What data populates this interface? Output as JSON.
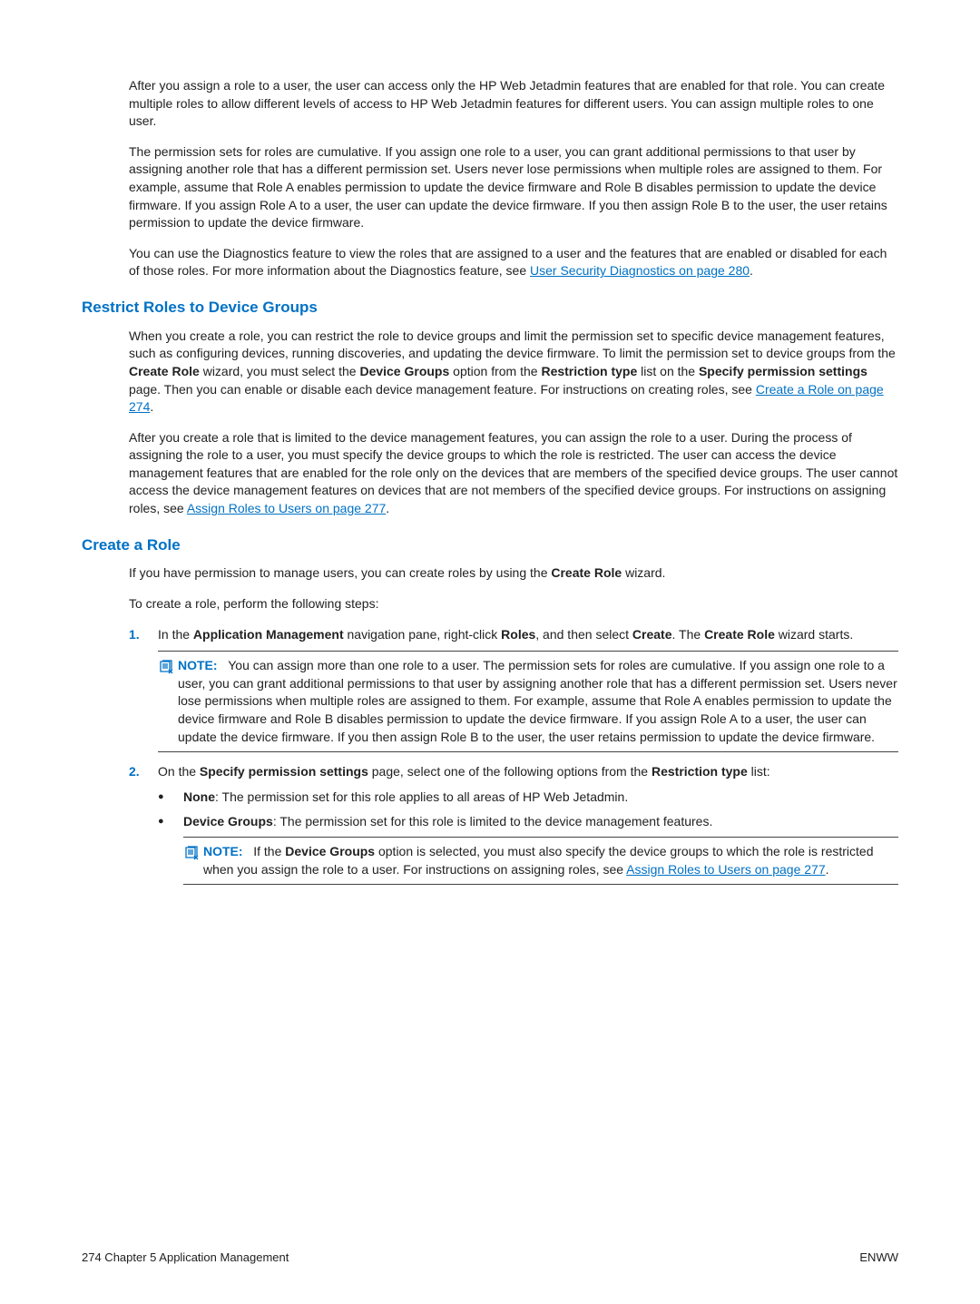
{
  "intro": {
    "p1": "After you assign a role to a user, the user can access only the HP Web Jetadmin features that are enabled for that role. You can create multiple roles to allow different levels of access to HP Web Jetadmin features for different users. You can assign multiple roles to one user.",
    "p2": "The permission sets for roles are cumulative. If you assign one role to a user, you can grant additional permissions to that user by assigning another role that has a different permission set. Users never lose permissions when multiple roles are assigned to them. For example, assume that Role A enables permission to update the device firmware and Role B disables permission to update the device firmware. If you assign Role A to a user, the user can update the device firmware. If you then assign Role B to the user, the user retains permission to update the device firmware.",
    "p3a": "You can use the Diagnostics feature to view the roles that are assigned to a user and the features that are enabled or disabled for each of those roles. For more information about the Diagnostics feature, see ",
    "p3link": "User Security Diagnostics on page 280",
    "p3b": "."
  },
  "restrict": {
    "heading": "Restrict Roles to Device Groups",
    "p1a": "When you create a role, you can restrict the role to device groups and limit the permission set to specific device management features, such as configuring devices, running discoveries, and updating the device firmware. To limit the permission set to device groups from the ",
    "bold1": "Create Role",
    "p1b": " wizard, you must select the ",
    "bold2": "Device Groups",
    "p1c": " option from the ",
    "bold3": "Restriction type",
    "p1d": " list on the ",
    "bold4": "Specify permission settings",
    "p1e": " page. Then you can enable or disable each device management feature. For instructions on creating roles, see ",
    "link1": "Create a Role on page 274",
    "p1f": ".",
    "p2a": "After you create a role that is limited to the device management features, you can assign the role to a user. During the process of assigning the role to a user, you must specify the device groups to which the role is restricted. The user can access the device management features that are enabled for the role only on the devices that are members of the specified device groups. The user cannot access the device management features on devices that are not members of the specified device groups. For instructions on assigning roles, see ",
    "link2": "Assign Roles to Users on page 277",
    "p2b": "."
  },
  "create": {
    "heading": "Create a Role",
    "p1a": "If you have permission to manage users, you can create roles by using the ",
    "bold1": "Create Role",
    "p1b": " wizard.",
    "p2": "To create a role, perform the following steps:",
    "step1_num": "1.",
    "step1a": "In the ",
    "step1b1": "Application Management",
    "step1c": " navigation pane, right-click ",
    "step1b2": "Roles",
    "step1d": ", and then select ",
    "step1b3": "Create",
    "step1e": ". The ",
    "step1b4": "Create Role",
    "step1f": " wizard starts.",
    "note1_label": "NOTE:",
    "note1_text": "You can assign more than one role to a user. The permission sets for roles are cumulative. If you assign one role to a user, you can grant additional permissions to that user by assigning another role that has a different permission set. Users never lose permissions when multiple roles are assigned to them. For example, assume that Role A enables permission to update the device firmware and Role B disables permission to update the device firmware. If you assign Role A to a user, the user can update the device firmware. If you then assign Role B to the user, the user retains permission to update the device firmware.",
    "step2_num": "2.",
    "step2a": "On the ",
    "step2b1": "Specify permission settings",
    "step2c": " page, select one of the following options from the ",
    "step2b2": "Restriction type",
    "step2d": " list:",
    "bullet1b": "None",
    "bullet1t": ": The permission set for this role applies to all areas of HP Web Jetadmin.",
    "bullet2b": "Device Groups",
    "bullet2t": ": The permission set for this role is limited to the device management features.",
    "note2_label": "NOTE:",
    "note2_a": "If the ",
    "note2_b": "Device Groups",
    "note2_c": " option is selected, you must also specify the device groups to which the role is restricted when you assign the role to a user. For instructions on assigning roles, see ",
    "note2_link": "Assign Roles to Users on page 277",
    "note2_d": "."
  },
  "footer": {
    "left": "274   Chapter 5   Application Management",
    "right": "ENWW"
  }
}
